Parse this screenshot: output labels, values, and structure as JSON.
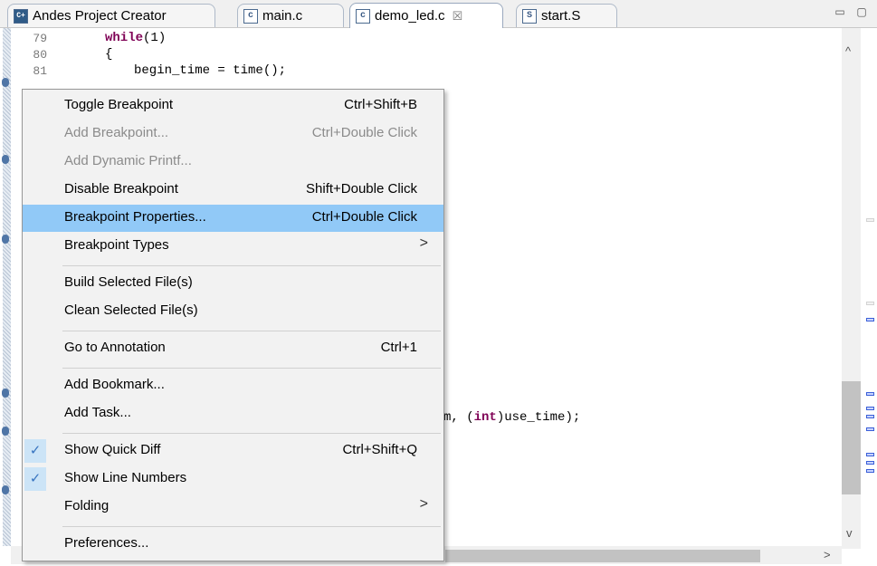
{
  "tabs": [
    {
      "label": "Andes Project Creator",
      "icon": "cpp-project-icon",
      "active": false
    },
    {
      "label": "main.c",
      "icon": "c-file-icon",
      "active": false
    },
    {
      "label": "demo_led.c",
      "icon": "c-file-icon",
      "active": true,
      "close_glyph": "☒"
    },
    {
      "label": "start.S",
      "icon": "asm-file-icon",
      "active": false
    }
  ],
  "tab_icons": {
    "cpp": "C+",
    "c": "c",
    "s": "S"
  },
  "window": {
    "minimize_glyph": "▭",
    "maximize_glyph": "▢"
  },
  "editor": {
    "lines": [
      {
        "num": "79",
        "keyword": "while",
        "rest": "(1)"
      },
      {
        "num": "80",
        "text": "{"
      },
      {
        "num": "81",
        "text": "begin_time = time();"
      }
    ],
    "visible_fragment": {
      "pre": "m, (",
      "keyword": "int",
      "post": ")use_time);"
    },
    "scroll_up": "^",
    "scroll_down": "v",
    "scroll_right": ">"
  },
  "context_menu": {
    "items": [
      {
        "label": "Toggle Breakpoint",
        "shortcut": "Ctrl+Shift+B",
        "enabled": true
      },
      {
        "label": "Add Breakpoint...",
        "shortcut": "Ctrl+Double Click",
        "enabled": false
      },
      {
        "label": "Add Dynamic Printf...",
        "shortcut": "",
        "enabled": false
      },
      {
        "label": "Disable Breakpoint",
        "shortcut": "Shift+Double Click",
        "enabled": true
      },
      {
        "label": "Breakpoint Properties...",
        "shortcut": "Ctrl+Double Click",
        "enabled": true,
        "highlighted": true
      },
      {
        "label": "Breakpoint Types",
        "submenu": ">"
      },
      {
        "label": "Build Selected File(s)",
        "shortcut": ""
      },
      {
        "label": "Clean Selected File(s)",
        "shortcut": ""
      },
      {
        "label": "Go to Annotation",
        "shortcut": "Ctrl+1"
      },
      {
        "label": "Add Bookmark...",
        "shortcut": ""
      },
      {
        "label": "Add Task...",
        "shortcut": ""
      },
      {
        "label": "Show Quick Diff",
        "shortcut": "Ctrl+Shift+Q",
        "checked": true,
        "check_glyph": "✓"
      },
      {
        "label": "Show Line Numbers",
        "shortcut": "",
        "checked": true,
        "check_glyph": "✓"
      },
      {
        "label": "Folding",
        "submenu": ">"
      },
      {
        "label": "Preferences...",
        "shortcut": ""
      }
    ]
  },
  "colors": {
    "highlight": "#91c9f7",
    "keyword": "#7f0055",
    "menu_bg": "#f2f2f2"
  }
}
